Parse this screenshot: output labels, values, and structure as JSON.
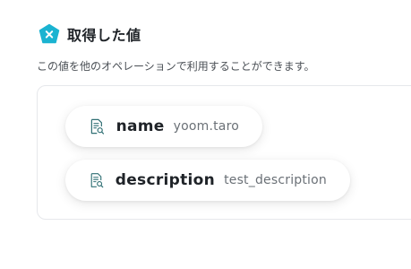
{
  "header": {
    "title": "取得した値",
    "icon": "yoom-x-badge-icon",
    "accent_color": "#1ab3d1"
  },
  "description": "この値を他のオペレーションで利用することができます。",
  "fields": [
    {
      "key": "name",
      "value": "yoom.taro",
      "icon": "document-search-icon"
    },
    {
      "key": "description",
      "value": "test_description",
      "icon": "document-search-icon"
    }
  ],
  "icon_color": "#2f6f73"
}
